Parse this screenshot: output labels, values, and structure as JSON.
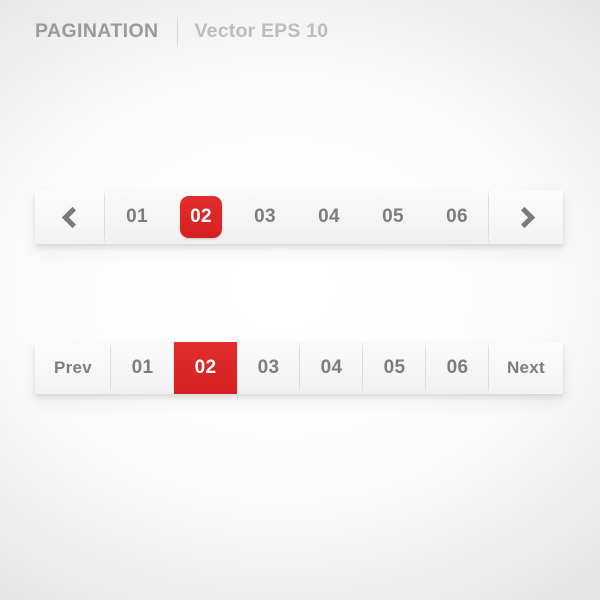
{
  "header": {
    "title": "PAGINATION",
    "subtitle": "Vector EPS 10"
  },
  "colors": {
    "accent_red": "#DC2727",
    "text_gray": "#7D7D7D",
    "title_gray": "#9A9A9A",
    "subtitle_gray": "#BCBCBC",
    "bar_background": "#F4F4F4",
    "page_background": "#FFFFFF",
    "page_edge": "#E6E6E6"
  },
  "pagers": [
    {
      "name": "arrow-pagination",
      "style": "rounded-active",
      "prev_icon": "chevron-left-icon",
      "next_icon": "chevron-right-icon",
      "active_page": "02",
      "pages": [
        "01",
        "02",
        "03",
        "04",
        "05",
        "06"
      ]
    },
    {
      "name": "text-pagination",
      "style": "square-active",
      "prev_label": "Prev",
      "next_label": "Next",
      "active_page": "02",
      "pages": [
        "01",
        "02",
        "03",
        "04",
        "05",
        "06"
      ]
    }
  ]
}
